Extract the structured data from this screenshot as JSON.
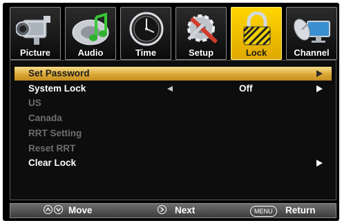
{
  "tabs": [
    {
      "label": "Picture",
      "icon": "camcorder-icon"
    },
    {
      "label": "Audio",
      "icon": "music-note-icon"
    },
    {
      "label": "Time",
      "icon": "clock-icon"
    },
    {
      "label": "Setup",
      "icon": "gear-tools-icon"
    },
    {
      "label": "Lock",
      "icon": "padlock-icon"
    },
    {
      "label": "Channel",
      "icon": "satellite-dish-icon"
    }
  ],
  "active_tab": "Lock",
  "menu": {
    "items": [
      {
        "label": "Set Password",
        "state": "selected"
      },
      {
        "label": "System Lock",
        "value": "Off",
        "state": "enabled"
      },
      {
        "label": "US",
        "state": "disabled"
      },
      {
        "label": "Canada",
        "state": "disabled"
      },
      {
        "label": "RRT Setting",
        "state": "disabled"
      },
      {
        "label": "Reset RRT",
        "state": "disabled"
      },
      {
        "label": "Clear Lock",
        "state": "enabled"
      }
    ]
  },
  "footer": {
    "move_label": "Move",
    "next_label": "Next",
    "menu_key": "MENU",
    "return_label": "Return"
  },
  "colors": {
    "accent": "#f0c200",
    "selected_row": "#e0b040",
    "background": "#000000"
  }
}
